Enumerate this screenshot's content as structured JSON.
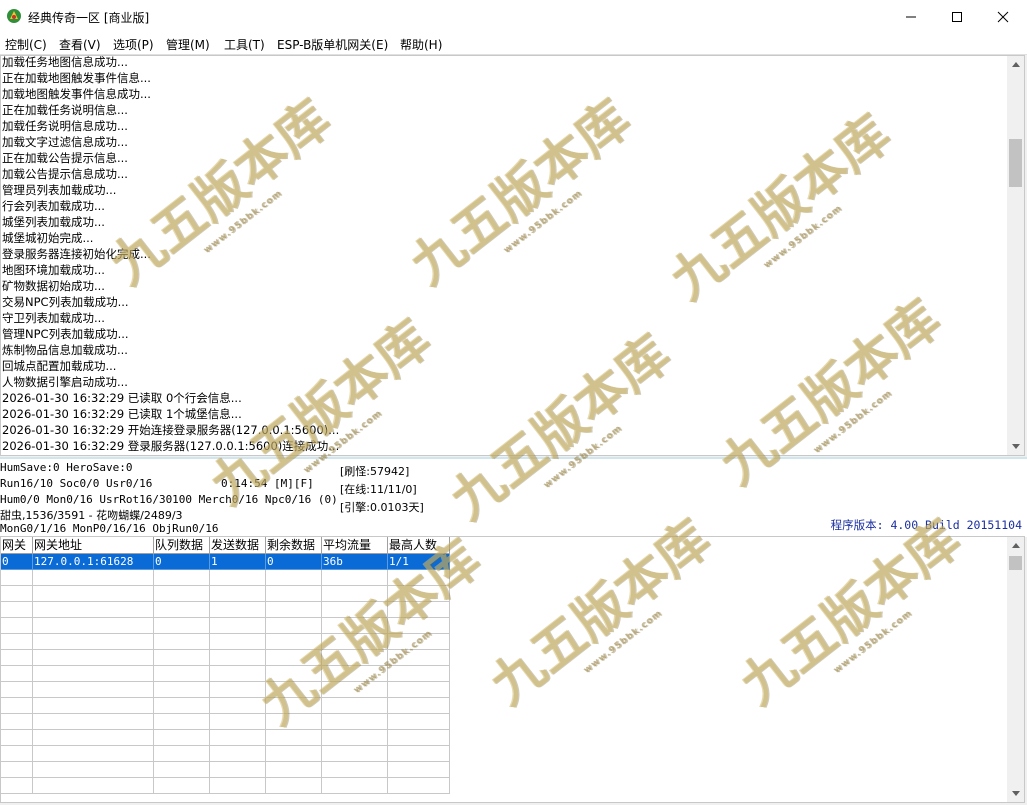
{
  "window": {
    "title": "经典传奇一区 [商业版]",
    "controls": {
      "minimize": "—",
      "maximize": "☐",
      "close": "✕"
    }
  },
  "menu": [
    "控制(C)",
    "查看(V)",
    "选项(P)",
    "管理(M)",
    "工具(T)",
    "ESP-B版单机网关(E)",
    "帮助(H)"
  ],
  "log": [
    "加载任务地图信息成功...",
    "正在加载地图触发事件信息...",
    "加载地图触发事件信息成功...",
    "正在加载任务说明信息...",
    "加载任务说明信息成功...",
    "加载文字过滤信息成功...",
    "正在加载公告提示信息...",
    "加载公告提示信息成功...",
    "管理员列表加载成功...",
    "行会列表加载成功...",
    "城堡列表加载成功...",
    "城堡城初始完成...",
    "登录服务器连接初始化完成...",
    "地图环境加载成功...",
    "矿物数据初始成功...",
    "交易NPC列表加载成功...",
    "守卫列表加载成功...",
    "管理NPC列表加载成功...",
    "炼制物品信息加载成功...",
    "回城点配置加载成功...",
    "人物数据引擎启动成功...",
    "2026-01-30 16:32:29 已读取 0个行会信息...",
    "2026-01-30 16:32:29 已读取 1个城堡信息...",
    "2026-01-30 16:32:29 开始连接登录服务器(127.0.0.1:5600)...",
    "2026-01-30 16:32:29 登录服务器(127.0.0.1:5600)连接成功..."
  ],
  "status": {
    "line1": "HumSave:0 HeroSave:0",
    "line2": "Run16/10 Soc0/0 Usr0/16",
    "timer": "0:14:54 [M][F]",
    "line3": "Hum0/0 Mon0/16 UsrRot16/30100 Merch0/16 Npc0/16 (0)",
    "line4": "甜虫,1536/3591 - 花吻蝴蝶/2489/3",
    "line5": "MonG0/1/16 MonP0/16/16 ObjRun0/16",
    "box1": "[刷怪:57942]",
    "box2": "[在线:11/11/0]",
    "box3": "[引擎:0.0103天]",
    "version": "程序版本: 4.00 Build 20151104"
  },
  "grid": {
    "columns": [
      "网关",
      "网关地址",
      "队列数据",
      "发送数据",
      "剩余数据",
      "平均流量",
      "最高人数"
    ],
    "rows": [
      [
        "0",
        "127.0.0.1:61628",
        "0",
        "1",
        "0",
        "36b",
        "1/1"
      ]
    ]
  },
  "watermark": {
    "text": "九五版本库",
    "url": "www.95bbk.com"
  },
  "colors": {
    "selection": "#0a6ad6",
    "version_text": "#1a2fa0"
  }
}
